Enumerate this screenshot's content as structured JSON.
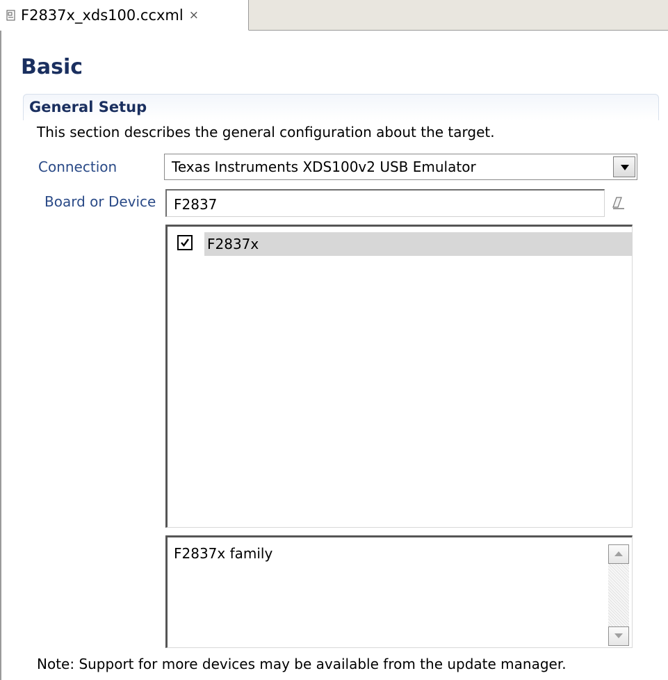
{
  "tab": {
    "label": "F2837x_xds100.ccxml",
    "icon": "target-config-file-icon",
    "close_icon": "close-icon"
  },
  "page": {
    "title": "Basic"
  },
  "general_setup": {
    "title": "General Setup",
    "description": "This section describes the general configuration about the target.",
    "connection": {
      "label": "Connection",
      "value": "Texas Instruments XDS100v2 USB Emulator"
    },
    "board_or_device": {
      "label": "Board or Device",
      "filter_value": "F2837",
      "clear_icon": "eraser-icon"
    },
    "devices": [
      {
        "label": "F2837x",
        "checked": true
      }
    ],
    "device_description": "F2837x family",
    "note": "Note: Support for more devices may be available from the update manager."
  },
  "colors": {
    "heading": "#1a2f5f",
    "label": "#2a4a87",
    "selection": "#d7d7d7"
  }
}
